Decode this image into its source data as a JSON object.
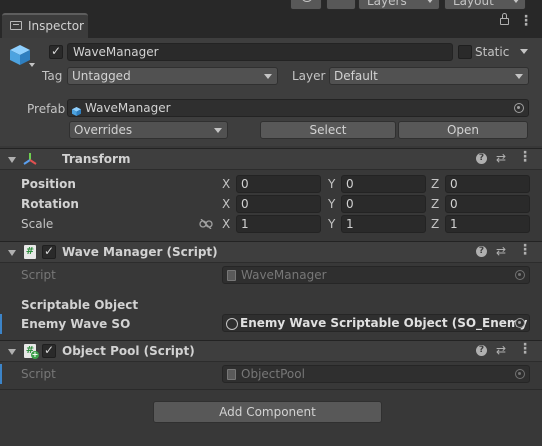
{
  "toolbar": {
    "layers_label": "Layers",
    "layout_label": "Layout"
  },
  "tab": {
    "title": "Inspector"
  },
  "header": {
    "name_value": "WaveManager",
    "static_label": "Static",
    "tag_label": "Tag",
    "tag_value": "Untagged",
    "layer_label": "Layer",
    "layer_value": "Default",
    "prefab_label": "Prefab",
    "prefab_value": "WaveManager",
    "overrides_label": "Overrides",
    "select_label": "Select",
    "open_label": "Open"
  },
  "transform": {
    "title": "Transform",
    "rows": [
      {
        "label": "Position",
        "x": "0",
        "y": "0",
        "z": "0"
      },
      {
        "label": "Rotation",
        "x": "0",
        "y": "0",
        "z": "0"
      },
      {
        "label": "Scale",
        "x": "1",
        "y": "1",
        "z": "1"
      }
    ],
    "axis": {
      "x": "X",
      "y": "Y",
      "z": "Z"
    }
  },
  "wave_manager": {
    "title": "Wave Manager (Script)",
    "script_label": "Script",
    "script_value": "WaveManager",
    "section_header": "Scriptable Object",
    "field_label": "Enemy Wave SO",
    "field_value": "Enemy Wave Scriptable Object (SO_Enemy Wa"
  },
  "object_pool": {
    "title": "Object Pool (Script)",
    "script_label": "Script",
    "script_value": "ObjectPool"
  },
  "add_component_label": "Add Component",
  "colors": {
    "background": "#383838",
    "accent": "#3c84c8",
    "field": "#2a2a2a",
    "header": "#3e3e3e"
  },
  "icons": [
    "history-icon",
    "search-icon",
    "lock-icon",
    "more-icon",
    "cube-icon",
    "transform-icon",
    "help-icon",
    "preset-icon",
    "script-icon",
    "object-picker-icon",
    "constrain-proportions-icon"
  ]
}
